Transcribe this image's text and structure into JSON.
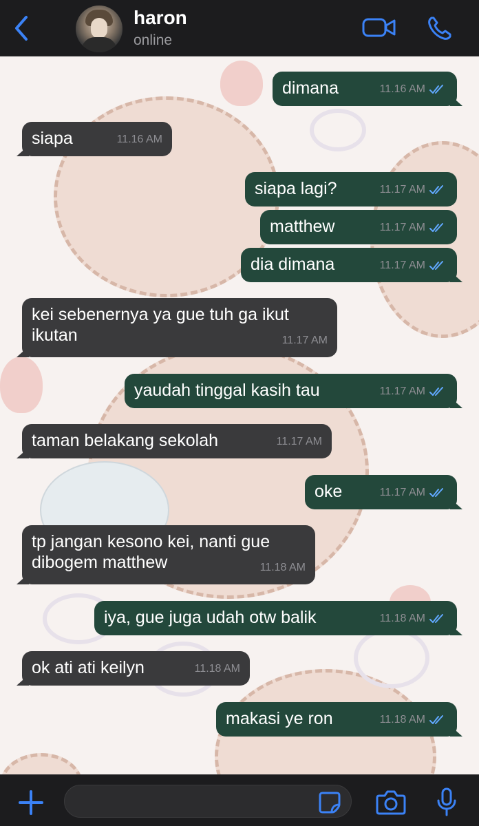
{
  "header": {
    "contact_name": "haron",
    "status": "online",
    "icons": [
      "back-chevron-icon",
      "video-call-icon",
      "phone-icon"
    ]
  },
  "theme": {
    "header_bg": "#1c1c1e",
    "accent": "#3b82f6",
    "outgoing_bubble": "#23483b",
    "incoming_bubble": "#3a3a3c",
    "read_tick": "#61a8ff"
  },
  "messages": [
    {
      "direction": "out",
      "text": "dimana",
      "time": "11.16 AM",
      "read": true
    },
    {
      "direction": "in",
      "text": "siapa",
      "time": "11.16 AM"
    },
    {
      "direction": "out",
      "text": "siapa lagi?",
      "time": "11.17 AM",
      "read": true
    },
    {
      "direction": "out",
      "text": "matthew",
      "time": "11.17 AM",
      "read": true
    },
    {
      "direction": "out",
      "text": "dia dimana",
      "time": "11.17 AM",
      "read": true
    },
    {
      "direction": "in",
      "text": "kei sebenernya ya gue tuh ga ikut\nikutan",
      "time": "11.17 AM"
    },
    {
      "direction": "out",
      "text": "yaudah tinggal kasih tau",
      "time": "11.17 AM",
      "read": true
    },
    {
      "direction": "in",
      "text": "taman belakang sekolah",
      "time": "11.17 AM"
    },
    {
      "direction": "out",
      "text": "oke",
      "time": "11.17 AM",
      "read": true
    },
    {
      "direction": "in",
      "text": "tp jangan kesono kei, nanti gue\ndibogem matthew",
      "time": "11.18 AM"
    },
    {
      "direction": "out",
      "text": "iya, gue juga udah otw balik",
      "time": "11.18 AM",
      "read": true
    },
    {
      "direction": "in",
      "text": "ok ati ati keilyn",
      "time": "11.18 AM"
    },
    {
      "direction": "out",
      "text": "makasi ye ron",
      "time": "11.18 AM",
      "read": true
    }
  ],
  "composer": {
    "placeholder": "",
    "icons": [
      "plus-icon",
      "sticker-icon",
      "camera-icon",
      "microphone-icon"
    ]
  }
}
